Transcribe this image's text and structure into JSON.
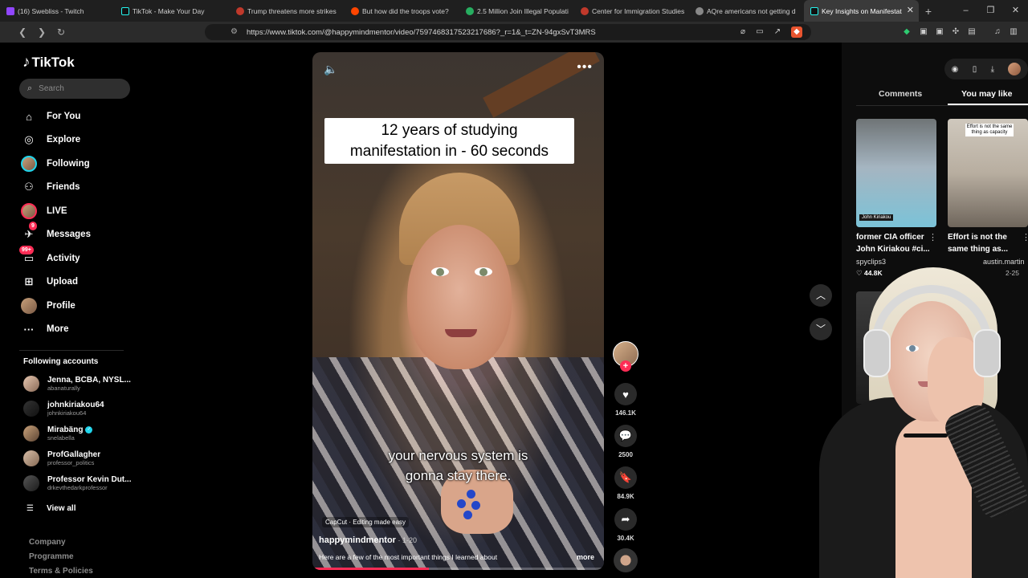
{
  "browser": {
    "tabs": [
      {
        "title": "(16) Swebliss - Twitch",
        "color": "#9146ff"
      },
      {
        "title": "TikTok - Make Your Day",
        "color": "#25f4ee"
      },
      {
        "title": "Trump threatens more strikes",
        "color": "#c0392b"
      },
      {
        "title": "But how did the troops vote?",
        "color": "#ff4500"
      },
      {
        "title": "2.5 Million Join Illegal Populati",
        "color": "#27ae60"
      },
      {
        "title": "Center for Immigration Studies",
        "color": "#c0392b"
      },
      {
        "title": "AQre americans not getting d",
        "color": "#888888"
      },
      {
        "title": "Key Insights on Manifestat",
        "color": "#25f4ee"
      }
    ],
    "new_tab": "+",
    "window_controls": {
      "minimize": "–",
      "maximize": "❐",
      "close": "✕"
    },
    "url": "https://www.tiktok.com/@happymindmentor/video/7597468317523217686?_r=1&_t=ZN-94gxSvT3MRS"
  },
  "tiktok": {
    "logo": "TikTok",
    "search_placeholder": "Search",
    "nav": [
      {
        "label": "For You",
        "icon": "home-icon"
      },
      {
        "label": "Explore",
        "icon": "compass-icon"
      },
      {
        "label": "Following",
        "icon": "avatar-icon"
      },
      {
        "label": "Friends",
        "icon": "friends-icon"
      },
      {
        "label": "LIVE",
        "icon": "live-icon"
      },
      {
        "label": "Messages",
        "icon": "messages-icon",
        "badge": "9"
      },
      {
        "label": "Activity",
        "icon": "activity-icon",
        "badge": "99+"
      },
      {
        "label": "Upload",
        "icon": "upload-icon"
      },
      {
        "label": "Profile",
        "icon": "profile-avatar-icon"
      },
      {
        "label": "More",
        "icon": "more-icon"
      }
    ],
    "following_title": "Following accounts",
    "following": [
      {
        "name": "Jenna, BCBA, NYSL...",
        "handle": "abanaturally",
        "verified": false
      },
      {
        "name": "johnkiriakou64",
        "handle": "johnkiriakou64",
        "verified": false
      },
      {
        "name": "Mirabäng",
        "handle": "snelabella",
        "verified": true
      },
      {
        "name": "ProfGallagher",
        "handle": "professor_politics",
        "verified": false
      },
      {
        "name": "Professor Kevin Dut...",
        "handle": "drkevthedarkprofessor",
        "verified": false
      }
    ],
    "view_all": "View all",
    "footer": [
      "Company",
      "Programme",
      "Terms & Policies"
    ]
  },
  "video": {
    "headline_line1": "12 years of studying",
    "headline_line2": "manifestation in - 60 seconds",
    "caption_line1": "your nervous system is",
    "caption_line2": "gonna stay there.",
    "capcut_label": "CapCut · Editing made easy",
    "author": "happymindmentor",
    "date": " · 1-20",
    "description": "Here are a few of the most important things I learned about",
    "more_label": "more",
    "progress": 0.4
  },
  "actions": {
    "likes": "146.1K",
    "comments": "2500",
    "saves": "84.9K",
    "shares": "30.4K"
  },
  "right_panel": {
    "tabs": [
      "Comments",
      "You may like"
    ],
    "active_tab": "You may like",
    "cards": [
      {
        "title_line1": "former CIA officer",
        "title_line2": "John Kiriakou #ci...",
        "author": "spyclips3",
        "likes": "♡ 44.8K",
        "thumb_label": "John Kiriakou"
      },
      {
        "title_line1": "Effort is not the",
        "title_line2": "same thing as...",
        "author": "austin.martin",
        "date": "2-25",
        "thumb_overlay": "Effort is not the same thing as capacity"
      }
    ]
  }
}
